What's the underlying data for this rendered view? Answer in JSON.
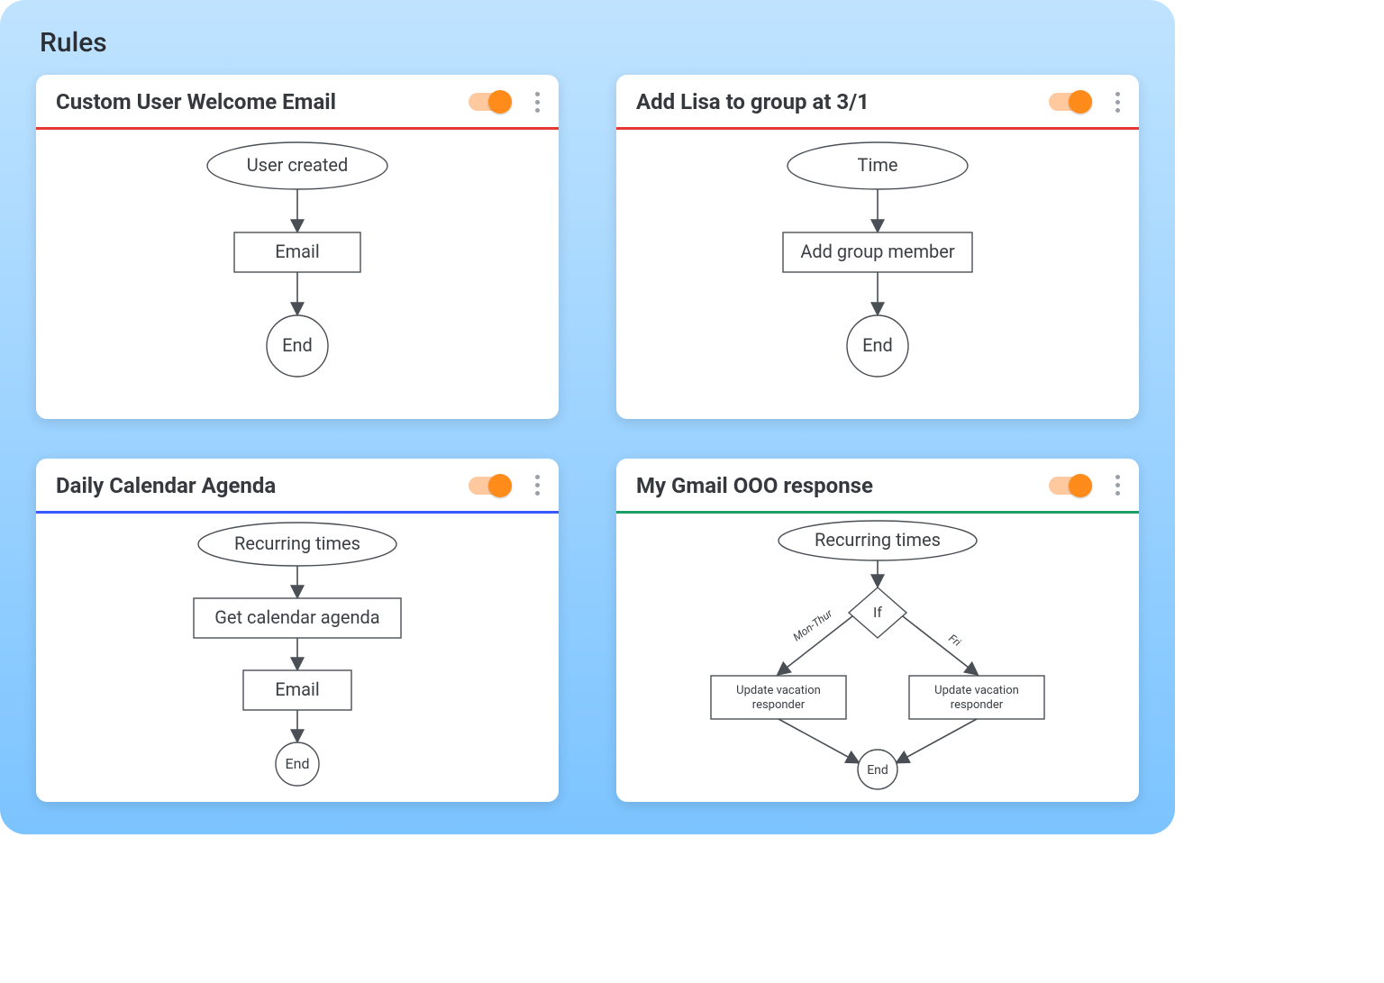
{
  "page": {
    "title": "Rules"
  },
  "cards": [
    {
      "id": "welcome",
      "title": "Custom User Welcome Email",
      "divider_color": "red",
      "toggle_on": true,
      "flow": {
        "trigger": "User created",
        "steps": [
          "Email"
        ],
        "end": "End"
      }
    },
    {
      "id": "lisa",
      "title": "Add Lisa to group at 3/1",
      "divider_color": "red",
      "toggle_on": true,
      "flow": {
        "trigger": "Time",
        "steps": [
          "Add group member"
        ],
        "end": "End"
      }
    },
    {
      "id": "agenda",
      "title": "Daily Calendar Agenda",
      "divider_color": "blue",
      "toggle_on": true,
      "flow": {
        "trigger": "Recurring times",
        "steps": [
          "Get calendar agenda",
          "Email"
        ],
        "end": "End"
      }
    },
    {
      "id": "ooo",
      "title": "My Gmail OOO response",
      "divider_color": "green",
      "toggle_on": true,
      "flow": {
        "trigger": "Recurring times",
        "condition": "If",
        "branches": [
          {
            "label": "Mon-Thur",
            "action": "Update vacation responder"
          },
          {
            "label": "Fri",
            "action": "Update vacation responder"
          }
        ],
        "end": "End"
      }
    }
  ]
}
